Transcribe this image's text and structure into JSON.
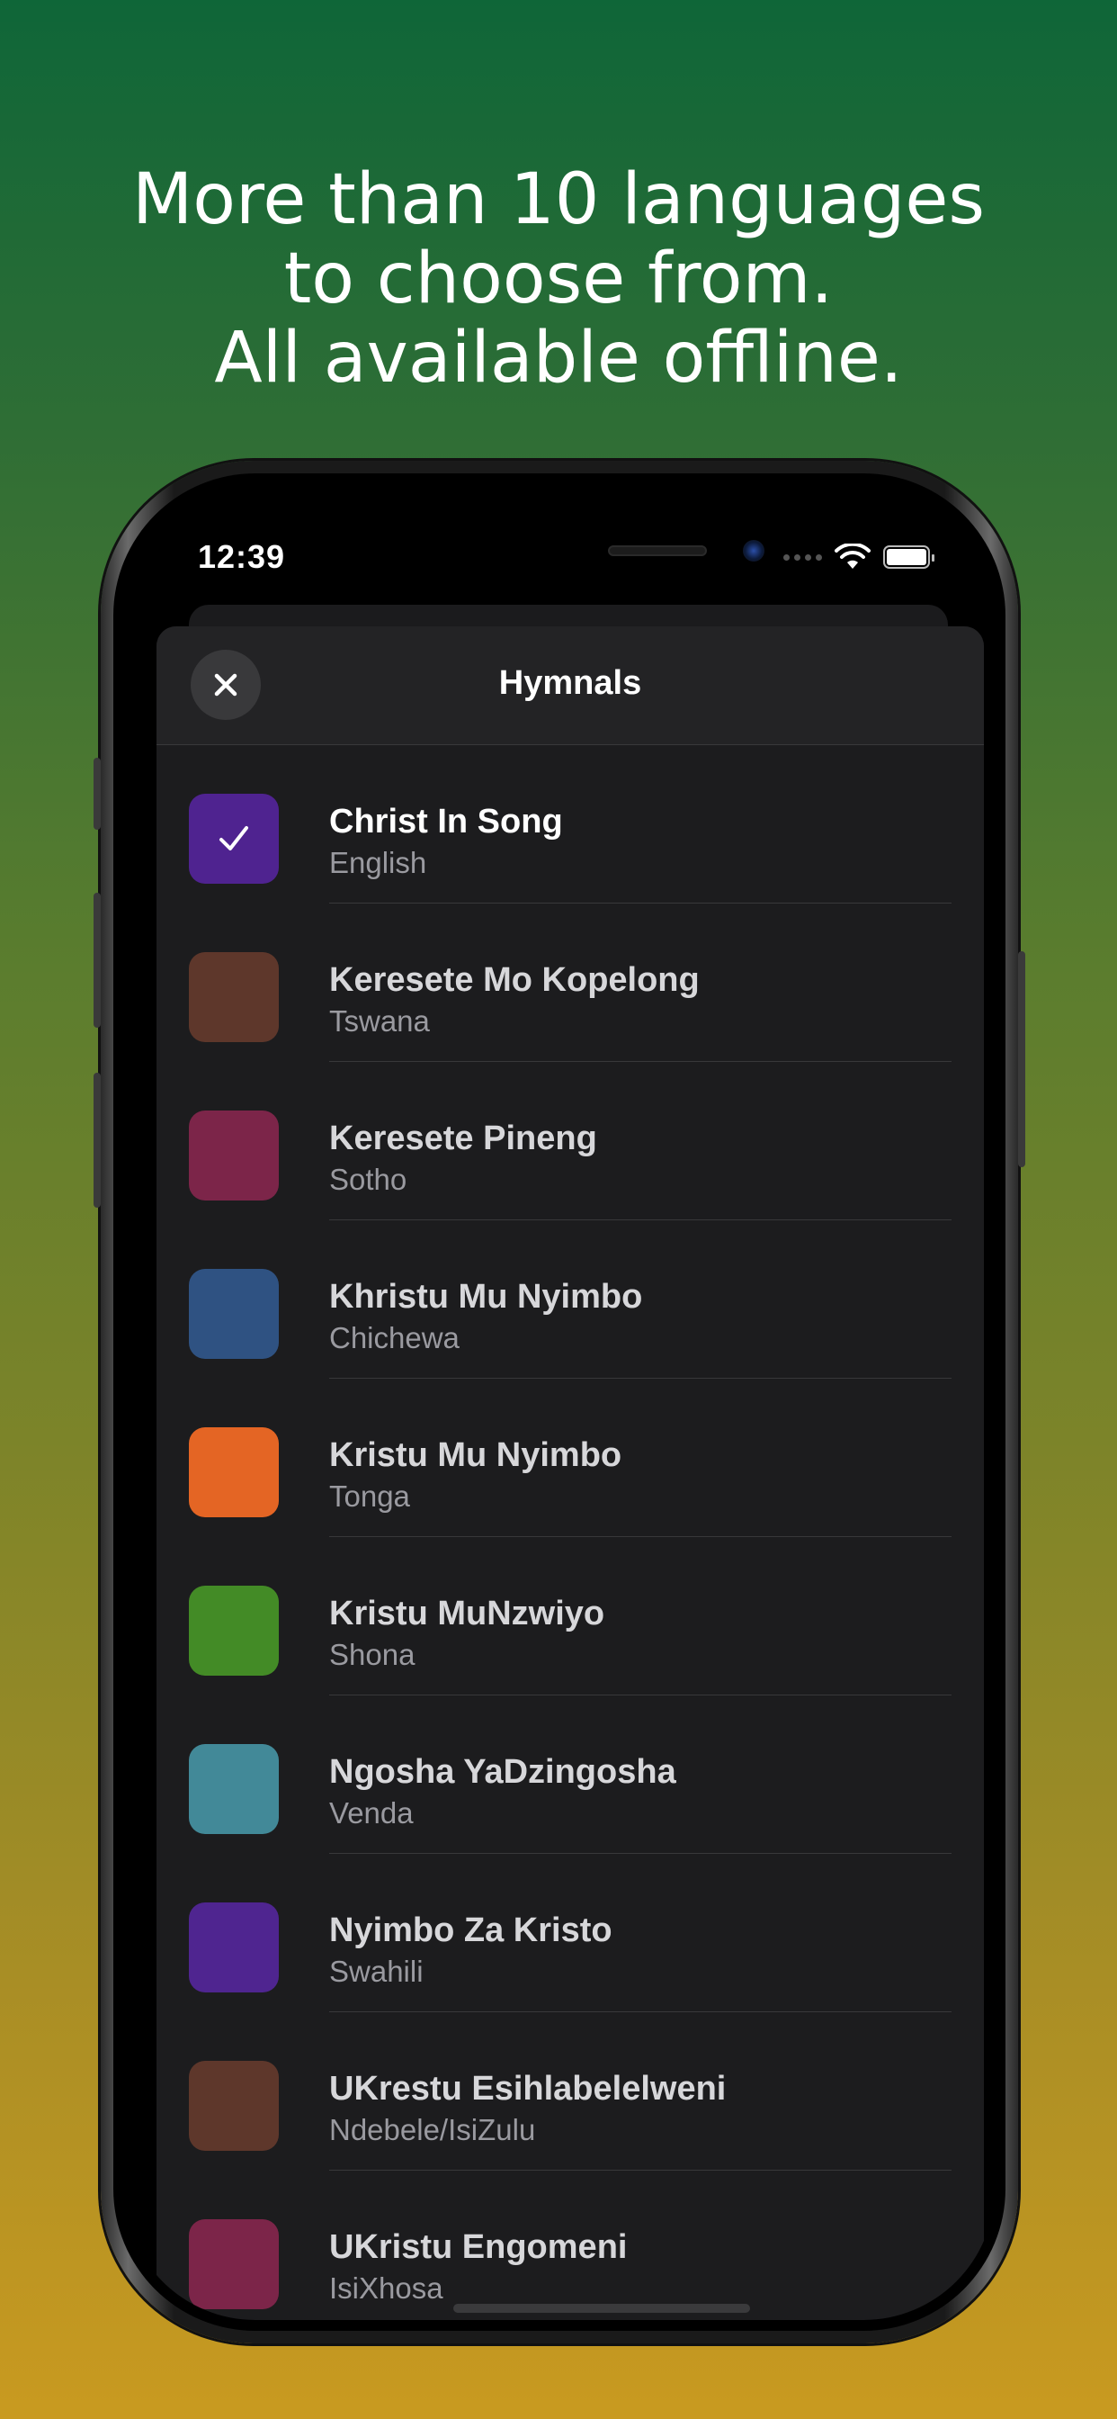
{
  "headline": {
    "line1": "More than 10 languages",
    "line2": "to choose from.",
    "line3": "All available offline."
  },
  "status_bar": {
    "time": "12:39"
  },
  "sheet": {
    "title": "Hymnals",
    "close_icon": "close-icon"
  },
  "hymnals": [
    {
      "title": "Christ In Song",
      "language": "English",
      "color": "#4f2390",
      "selected": true
    },
    {
      "title": "Keresete Mo Kopelong",
      "language": "Tswana",
      "color": "#5e372b"
    },
    {
      "title": "Keresete Pineng",
      "language": "Sotho",
      "color": "#7c2549"
    },
    {
      "title": "Khristu Mu Nyimbo",
      "language": "Chichewa",
      "color": "#2f5282"
    },
    {
      "title": "Kristu Mu Nyimbo",
      "language": "Tonga",
      "color": "#e46524"
    },
    {
      "title": "Kristu MuNzwiyo",
      "language": "Shona",
      "color": "#438b26"
    },
    {
      "title": "Ngosha YaDzingosha",
      "language": "Venda",
      "color": "#428998"
    },
    {
      "title": "Nyimbo Za Kristo",
      "language": "Swahili",
      "color": "#4f2590"
    },
    {
      "title": "UKrestu Esihlabelelweni",
      "language": "Ndebele/IsiZulu",
      "color": "#5e372b"
    },
    {
      "title": "UKristu Engomeni",
      "language": "IsiXhosa",
      "color": "#7c2549"
    }
  ]
}
